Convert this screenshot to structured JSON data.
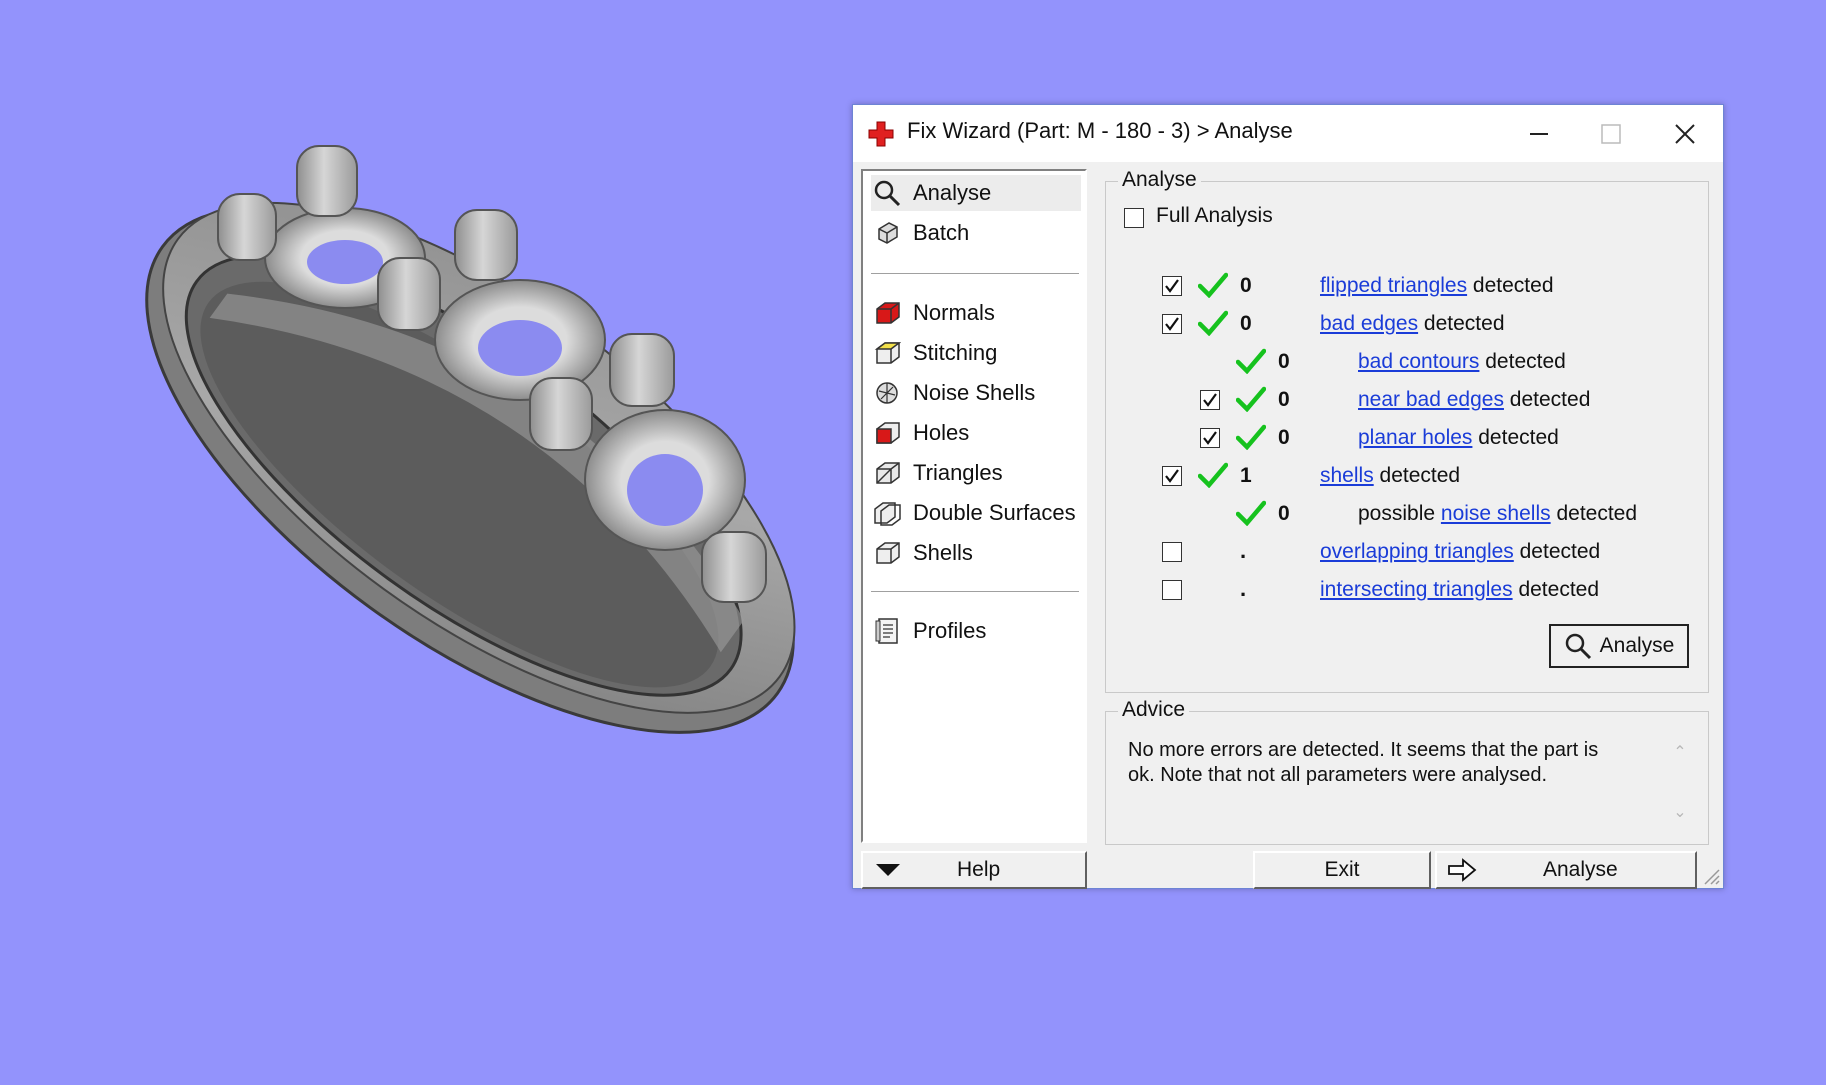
{
  "window": {
    "title": "Fix Wizard (Part: M - 180 - 3) > Analyse"
  },
  "nav": {
    "top_items": [
      {
        "label": "Analyse",
        "icon": "magnifier-icon"
      },
      {
        "label": "Batch",
        "icon": "batch-icon"
      }
    ],
    "tool_items": [
      {
        "label": "Normals",
        "icon": "normals-icon"
      },
      {
        "label": "Stitching",
        "icon": "stitching-icon"
      },
      {
        "label": "Noise Shells",
        "icon": "noise-shells-icon"
      },
      {
        "label": "Holes",
        "icon": "holes-icon"
      },
      {
        "label": "Triangles",
        "icon": "triangles-icon"
      },
      {
        "label": "Double Surfaces",
        "icon": "double-surfaces-icon"
      },
      {
        "label": "Shells",
        "icon": "shells-icon"
      }
    ],
    "bottom_items": [
      {
        "label": "Profiles",
        "icon": "profiles-icon"
      }
    ]
  },
  "analyse": {
    "legend": "Analyse",
    "full_analysis_label": "Full Analysis",
    "full_analysis_checked": false,
    "rows": [
      {
        "checked": true,
        "ok": true,
        "value": "0",
        "prefix": "",
        "link": "flipped triangles",
        "suffix": " detected"
      },
      {
        "checked": true,
        "ok": true,
        "value": "0",
        "prefix": "",
        "link": "bad edges",
        "suffix": " detected"
      },
      {
        "checked": null,
        "ok": true,
        "value": "0",
        "prefix": "",
        "link": "bad contours",
        "suffix": " detected"
      },
      {
        "checked": true,
        "ok": true,
        "value": "0",
        "prefix": "",
        "link": "near bad edges",
        "suffix": " detected"
      },
      {
        "checked": true,
        "ok": true,
        "value": "0",
        "prefix": "",
        "link": "planar holes",
        "suffix": " detected"
      },
      {
        "checked": true,
        "ok": true,
        "value": "1",
        "prefix": "",
        "link": "shells",
        "suffix": " detected"
      },
      {
        "checked": null,
        "ok": true,
        "value": "0",
        "prefix": "possible ",
        "link": "noise shells",
        "suffix": " detected"
      },
      {
        "checked": false,
        "ok": false,
        "value": ".",
        "prefix": "",
        "link": "overlapping triangles",
        "suffix": " detected"
      },
      {
        "checked": false,
        "ok": false,
        "value": ".",
        "prefix": "",
        "link": "intersecting triangles",
        "suffix": " detected"
      }
    ],
    "analyse_button": "Analyse"
  },
  "advice": {
    "legend": "Advice",
    "text": "No more errors are detected. It seems that the part is ok. Note that not all parameters were analysed."
  },
  "footer": {
    "help_label": "Help",
    "exit_label": "Exit",
    "analyse_label": "Analyse"
  },
  "colors": {
    "background": "#9393fc",
    "check_green": "#16c21e",
    "link_blue": "#1a3cd8",
    "title_icon_red": "#e02020"
  }
}
